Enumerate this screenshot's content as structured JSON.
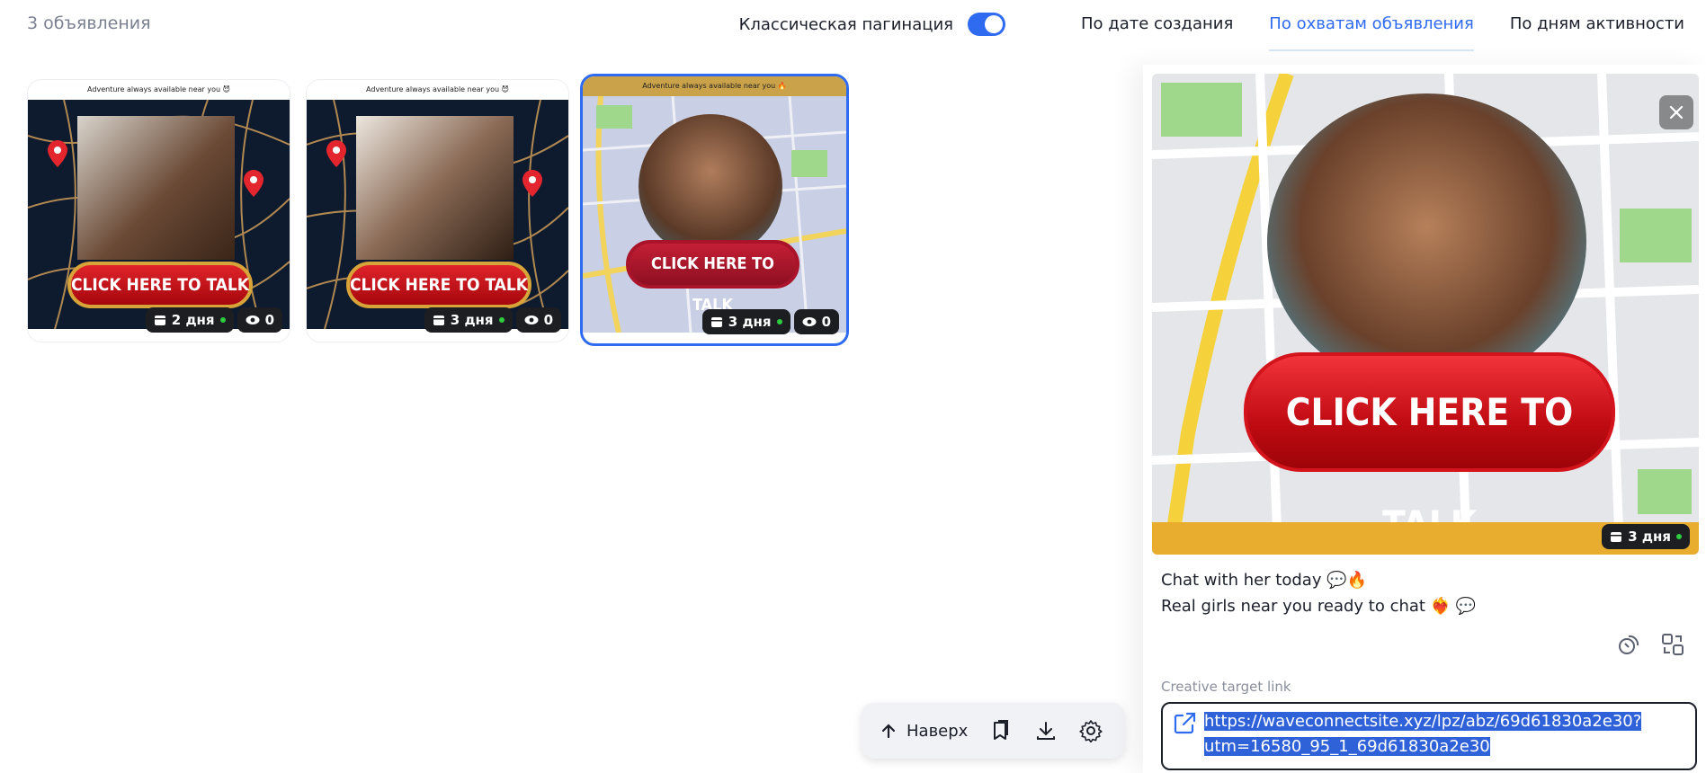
{
  "header": {
    "count_text": "3 объявления",
    "pagination_label": "Классическая пагинация",
    "pagination_enabled": true,
    "sort_options": [
      "По дате создания",
      "По охватам объявления",
      "По дням активности"
    ],
    "active_sort": "По охватам объявления"
  },
  "cards": [
    {
      "headline": "Adventure always available near you 😈",
      "cta": "CLICK HERE TO TALK",
      "days": "2 дня",
      "views": "0",
      "map_style": "dark",
      "selected": false
    },
    {
      "headline": "Adventure always available near you 😈",
      "cta": "CLICK HERE TO TALK",
      "days": "3 дня",
      "views": "0",
      "map_style": "dark",
      "selected": false
    },
    {
      "headline": "Adventure always available near you 🔥",
      "cta": "CLICK HERE TO TALK",
      "days": "3 дня",
      "views": "0",
      "map_style": "light",
      "selected": true
    }
  ],
  "detail": {
    "cta": "CLICK HERE TO TALK",
    "days": "3 дня",
    "title": "Chat with her today 💬🔥",
    "description": "Real girls near you ready to chat ❤️‍🔥 💬",
    "link_label": "Creative target link",
    "link_line1": "https://waveconnectsite.xyz/lpz/abz/69d61830a2e30?",
    "link_line2": "utm=16580_95_1_69d61830a2e30"
  },
  "floatbar": {
    "up_label": "Наверх"
  },
  "colors": {
    "accent": "#2f6bf0",
    "badge_bg": "#1c1e22",
    "status_dot": "#2ecc40",
    "cta_red": "#d8141d"
  },
  "icons": [
    "calendar-icon",
    "eye-icon",
    "close-icon",
    "copy-icon",
    "translate-icon",
    "external-link-icon",
    "arrow-up-icon",
    "bookmark-icon",
    "download-icon",
    "gear-icon"
  ]
}
